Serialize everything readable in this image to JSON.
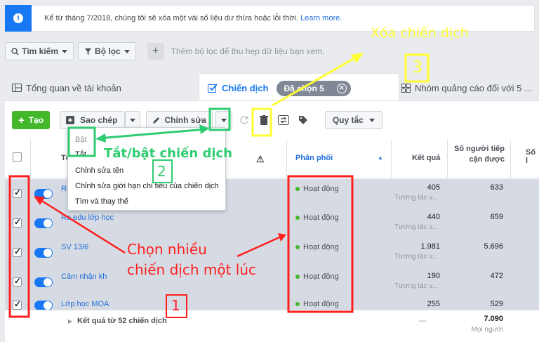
{
  "notice": {
    "text": "Kể từ tháng 7/2018, chúng tôi sẽ xóa một vài số liệu dư thừa hoặc lỗi thời.",
    "link": "Learn more."
  },
  "search": {
    "search_label": "Tìm kiếm",
    "filter_label": "Bộ lọc",
    "placeholder": "Thêm bộ lọc để thu hẹp dữ liệu bạn xem."
  },
  "tabs": {
    "overview": "Tổng quan về tài khoản",
    "campaigns": "Chiến dịch",
    "selected_chip": "Đã chọn 5",
    "adsets": "Nhóm quảng cáo đối với 5 ..."
  },
  "toolbar": {
    "create": "Tạo",
    "duplicate": "Sao chép",
    "edit": "Chỉnh sửa",
    "rules": "Quy tắc"
  },
  "dropdown": {
    "items": [
      "Bật",
      "Tắt",
      "Chỉnh sửa tên",
      "Chỉnh sửa giới hạn chi tiêu của chiến dịch",
      "Tìm và thay thế"
    ]
  },
  "table": {
    "headers": {
      "name": "Tê",
      "delivery": "Phân phối",
      "results": "Kết quả",
      "reach": "Số người tiếp cận được",
      "impressions": "Số l"
    },
    "rows": [
      {
        "name": "Re",
        "status": "Hoạt động",
        "results": "405",
        "results_sub": "Tương tác v...",
        "reach": "633"
      },
      {
        "name": "Re edu lớp học",
        "status": "Hoạt động",
        "results": "440",
        "results_sub": "Tương tác v...",
        "reach": "659"
      },
      {
        "name": "SV 13/6",
        "status": "Hoạt động",
        "results": "1.981",
        "results_sub": "Tương tác v...",
        "reach": "5.696"
      },
      {
        "name": "Cảm nhận kh",
        "status": "Hoạt động",
        "results": "190",
        "results_sub": "Tương tác v...",
        "reach": "472"
      },
      {
        "name": "Lớp học MOA",
        "status": "Hoạt động",
        "results": "255",
        "results_sub": "",
        "reach": "529"
      }
    ],
    "footer": {
      "label": "Kết quả từ 52 chiến dịch",
      "results": "—",
      "reach": "7.090",
      "reach_sub": "Mọi người"
    }
  },
  "annotations": {
    "delete_campaign": "Xóa chiến dịch",
    "toggle_campaign": "Tắt/bật chiến dịch",
    "multi_select_line1": "Chọn nhiều",
    "multi_select_line2": "chiến dịch một lúc",
    "num1": "1",
    "num2": "2",
    "num3": "3"
  },
  "colors": {
    "accent": "#1877f2",
    "active_green": "#42b72a",
    "annotation_red": "#ff1f1f",
    "annotation_yellow": "#ffff33",
    "annotation_green": "#2ecc71"
  }
}
